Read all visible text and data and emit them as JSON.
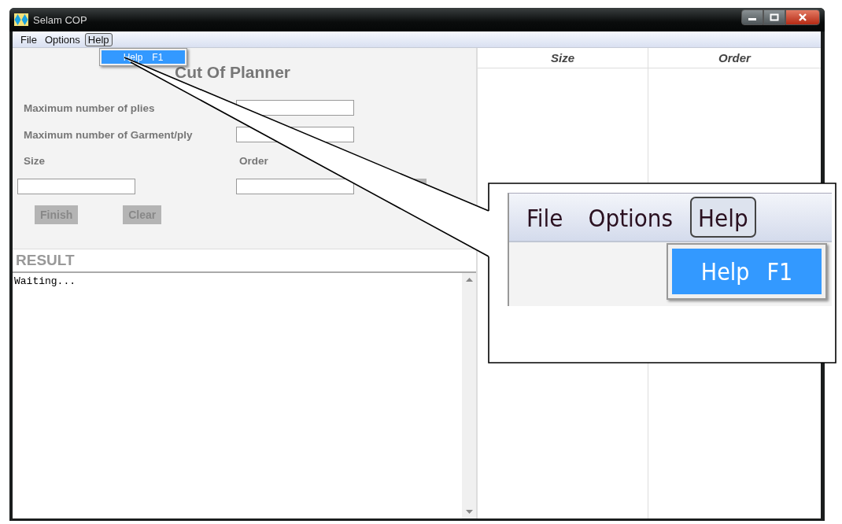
{
  "window": {
    "title": "Selam COP"
  },
  "menu_bar": {
    "menus": [
      {
        "label": "File",
        "selected": false
      },
      {
        "label": "Options",
        "selected": false
      },
      {
        "label": "Help",
        "selected": true
      }
    ],
    "dropdown": [
      {
        "label": "Help",
        "shortcut": "F1",
        "selected": true
      }
    ]
  },
  "form": {
    "title": "Cut Of Planner",
    "fields": [
      {
        "label": "Maximum number of plies"
      },
      {
        "label": "Maximum number of Garment/ply"
      }
    ],
    "entry_labels": [
      "Size",
      "Order"
    ],
    "buttons": [
      {
        "label": "Finish",
        "disabled": true
      },
      {
        "label": "Clear",
        "disabled": true
      }
    ]
  },
  "result": {
    "heading": "RESULT",
    "text": "Waiting..."
  },
  "table": {
    "columns": [
      "Size",
      "Order"
    ]
  },
  "callout": {
    "menus": [
      {
        "label": "File",
        "selected": false
      },
      {
        "label": "Options",
        "selected": false
      },
      {
        "label": "Help",
        "selected": true
      }
    ],
    "dropdown": [
      {
        "label": "Help",
        "shortcut": "F1",
        "selected": true
      }
    ]
  }
}
